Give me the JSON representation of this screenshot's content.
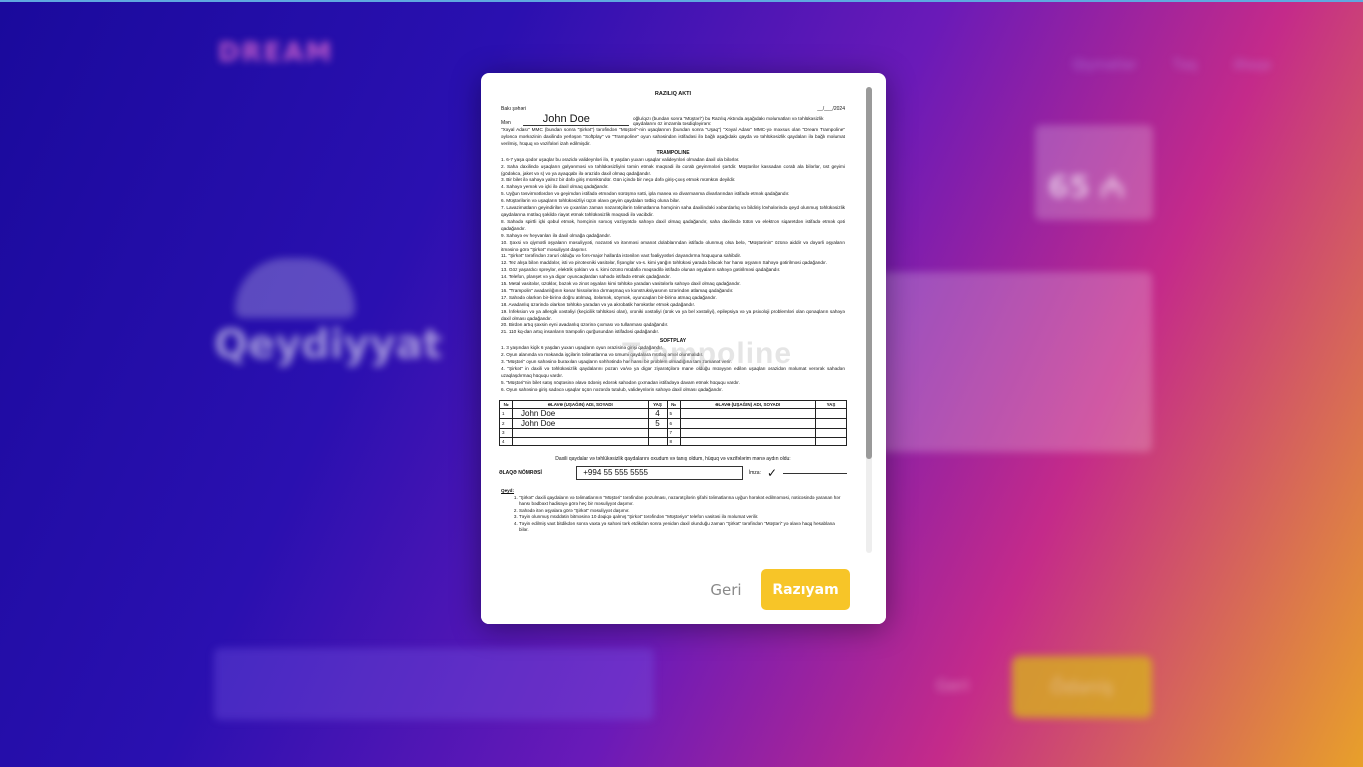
{
  "background": {
    "logo_text": "DREAM",
    "nav_items": [
      "Qiymətlər",
      "Təq",
      "Əlaqə"
    ],
    "page_title": "Qeydiyyat",
    "price_text": "65 ₼",
    "back_label": "Geri",
    "next_label": "Ödəniş"
  },
  "modal": {
    "document": {
      "title": "RAZILIQ AKTI",
      "city": "Bakı şəhəri",
      "date": "__/___/2024",
      "name_prefix": "Mən",
      "parent_name": "John Doe",
      "name_suffix": "oğlu/qızı (bundan sonra \"Müştəri\") bu Razılıq Aktında aşağıdakı məlumatları və təhlükəsizlik qaydalarını öz imzamla təsdiqləyirəm:",
      "intro": "\"Xəyal Adası\" MMC (bundan sonra \"Şirkət\") tərəfindən \"Müştəri\"-nin uşaqlarının (bundan sonra \"Uşaq\") \"Xəyal Adası\" MMC-yə məxsus olan \"Dream Trampoline\" əyləncə mərkəzinin daxilində yerləşən \"Softplay\" və \"Trampoline\" oyun sahəsindən istifadəsi ilə bağlı aşağıdakı qayda və təhlükəsizlik qaydaları ilə bağlı məlumat verilmiş, hüquq və vəzifələri izah edilmişdir.",
      "section_trampoline": "TRAMPOLINE",
      "trampoline_rules": [
        "1. 6-7 yaşa qədər uşaqlar bu ərazidə valideynləri ilə, 8 yaşdan yuxarı uşaqlar valideynləri olmadan daxil ola bilərlər.",
        "2. Saha daxilində uşaqların gəlyənməsi və təhlükəsizliyini təmin etmək məqsədi ilə corab geyinmələri şərtdir. Müştərilər kassadan corab ala bilərlər, üst geyimi (gödəkcə, jaket və s) və ya ayaqqabı ilə ərazidə daxil olmaq qadağandır.",
        "3. Bir bilet ilə sahəyə yalnız bir dəfə giriş mümkündür. Gün içində bir neçə dəfə giriş-çıxış etmək mümkün deyildir.",
        "4. Sahəyə yemək və içki ilə daxil olmaq qadağandır.",
        "5. Uyğun təsvirmətlərdən və geyimdən istifadə etmədən sürüşmə sətti, ipla manea və divarmanma divarlarından istifadə etmək qadağandır.",
        "6. Müştərilərin və uşaqların təhlükəsizliyi üçün əlavə geyim qaydaları tətbiq oluna bilər.",
        "7. Lavazimatların geyindirilən və çıxarılan zaman nəzarətçilərin təlimatlarına həmçinin saha daxilindəki xəbərdarlıq və bildiriş lövhələrində qeyd olunmuş təhlükəsizlik qaydalarına mütləq şəkildə riayət etmək təhlükəsizlik məqsədi ilə vacibdir.",
        "8. Sahədə spirtli içki qəbul etmək, həmçinin sərxoş vəziyyətdə sahəyə daxil olmaq qadağandır, saha daxilində tütün və elektron siqaretdən istifadə etmək qəti qadağandır.",
        "9. Sahəyə ev heyvanları ilə daxil olmağa qadağandır.",
        "10. Şəxsi və qiymətli əşyaların məsuliyyəti, nəzarəti və itənməsi əmanət dolablarından istifadə olunmuş olsa belə, \"Müştərinin\" özünə aiddir və dəyərli əşyaların itməsinə görə \"Şirkət\" məsuliyyət daşımır.",
        "11. \"Şirkət\" tərəfindən zərurі olduğu və fors-major hallarda istənilən vaxt fəaliyyətləri dayandırma hüququna sahibdir.",
        "12. Tez alışa bilən maddələr, isti və pirotexniki vasitələr, fişənglər və-s. kimi yanğın təhlükəsi yarada biləcək hər hansı əşyanın Sahəyə gətirilməsi qadağandır.",
        "13. Göz yaşardıcı spreylər, elektrik şokları və s. kimi özünü müdafiə məqsədilə istifadə olunan əşyaların sahəyə gətirilməsi qadağandır.",
        "14. Telefon, planşet və ya digər oyuncaqlardan sahədə istifadə etmək qadağandır.",
        "15. Metal vasitələr, üzüklər, bəzək və zinət əşyaları kimi təhlükə yaradan vasitələrlə sahəyə daxil olmaq qadağandır.",
        "16. \"Trampolin\" avadanlığının kənar hissələrinə dırmaşmaq və konstruksiyasının üzərindən atlamaq qadağandır.",
        "17. Sahədə olarkən bir-birinə doğru atılmaq, itələmək, söymək, oyuncaqları bir-birinə atmaq qadağandır.",
        "18. Avadanlıq üzərində olarkən təhlükə yaradan və ya akrobatik hərəkətlər etmək qadağandır.",
        "19. İnfeksion və ya allergik xəstəliyi (keçicilik təhlükəsi olan), xroniki xəstəliyi (ürək və ya bel xəstəliyi), epilepsiya və ya psixoloji problemləri olan qonaqların sahəyə daxil olması qadağandır.",
        "20. Birdən artıq şəxsin eyni avadanlıq üzərinə çıxması və tullanması qadağandır.",
        "21. 110 kq-dan artıq insanların trampolin qurğusundan istifadəsi qadağandır."
      ],
      "section_softplay": "SOFTPLAY",
      "softplay_rules": [
        "1. 3 yaşından kiçik 6 yaşdan yuxarı uşaqların oyun ərazisinə girişi qadağandır.",
        "2. Oyun alanında və məkanda işçilərin təlimatlarına və ümumi qaydalara mütləq əməl olunmalıdır.",
        "3. \"Müştəri\" oyun sahəsinə buraxılan uşaqların səhhətində hər hansı bir problem olmadığına tam zəmanət verir.",
        "4. \"Şirkət\" in daxili və təhlükəsizlik qaydalarını pozan və/və ya digər ziyarətçilərə mane olduğu müəyyən edilən uşaqları ərazidən məlumat verərək sahədən uzaqlaşdırmaq hüququ vardır.",
        "5. \"Müştəri\"nin bilet satış nöqtəsinə əlavə ödəniş edərək sahədən çıxmadan istifadəyə davam etmək hüququ vardır.",
        "6. Oyun sahəsinə giriş sadəcə uşaqlar üçün nəzərdə tutulub, valideynlərin sahəyə daxil olması qadağandır."
      ],
      "table": {
        "headers": [
          "№",
          "ƏLAVƏ (UŞAĞIN) ADI, SOYADI",
          "YAŞ",
          "№",
          "ƏLAVƏ (UŞAĞIN) ADI, SOYADI",
          "YAŞ"
        ],
        "rows": [
          {
            "n1": "1",
            "name1": "John Doe",
            "age1": "4",
            "n2": "5",
            "name2": "",
            "age2": ""
          },
          {
            "n1": "2",
            "name1": "John Doe",
            "age1": "5",
            "n2": "6",
            "name2": "",
            "age2": ""
          },
          {
            "n1": "3",
            "name1": "",
            "age1": "",
            "n2": "7",
            "name2": "",
            "age2": ""
          },
          {
            "n1": "4",
            "name1": "",
            "age1": "",
            "n2": "8",
            "name2": "",
            "age2": ""
          }
        ]
      },
      "confirm_text": "Daxili qaydalar və təhlükəsizlik qaydalarını oxudum və tanış oldum, hüquq və vəzifələrim mənə aydın oldu:",
      "contact_label": "ƏLAQƏ NÖMRƏSİ",
      "phone": "+994 55 555 5555",
      "sign_label": "İmza:",
      "sign_mark": "✓",
      "notes_title": "Qeyd:",
      "notes": [
        "\"Şirkət\" daxili qaydaların və təlimatlarının \"Müştəri\" tərəfindən pozulması, nəzarətçilərin şifahi təlimatlarına uyğun hərəkət edilməməsi, nəticəsində yaranan hər hansı bədbəxt hadisəyə görə heç bir məsuliyyət daşımır.",
        "Sahədə itən əşyalara görə \"Şirkət\" məsuliyyət daşımır.",
        "Təyin olunmuş müddətin bitməsinə 10 dəqiqə qalmış \"Şirkət\" tərəfindən \"Müştəriyə\" telefon vasitəsi ilə məlumat verilir.",
        "Təyin edilmiş vaxt bitdikdən sonra vaxta yə sahəni tərk etdikdən sonra yenidən daxil olunduğu zaman \"Şirkət\" tərəfindən \"Müştəri\" yə əlavə haqq hesablana bilər."
      ],
      "watermark": "Trampoline"
    },
    "buttons": {
      "back_label": "Geri",
      "agree_label": "Razıyam"
    }
  }
}
